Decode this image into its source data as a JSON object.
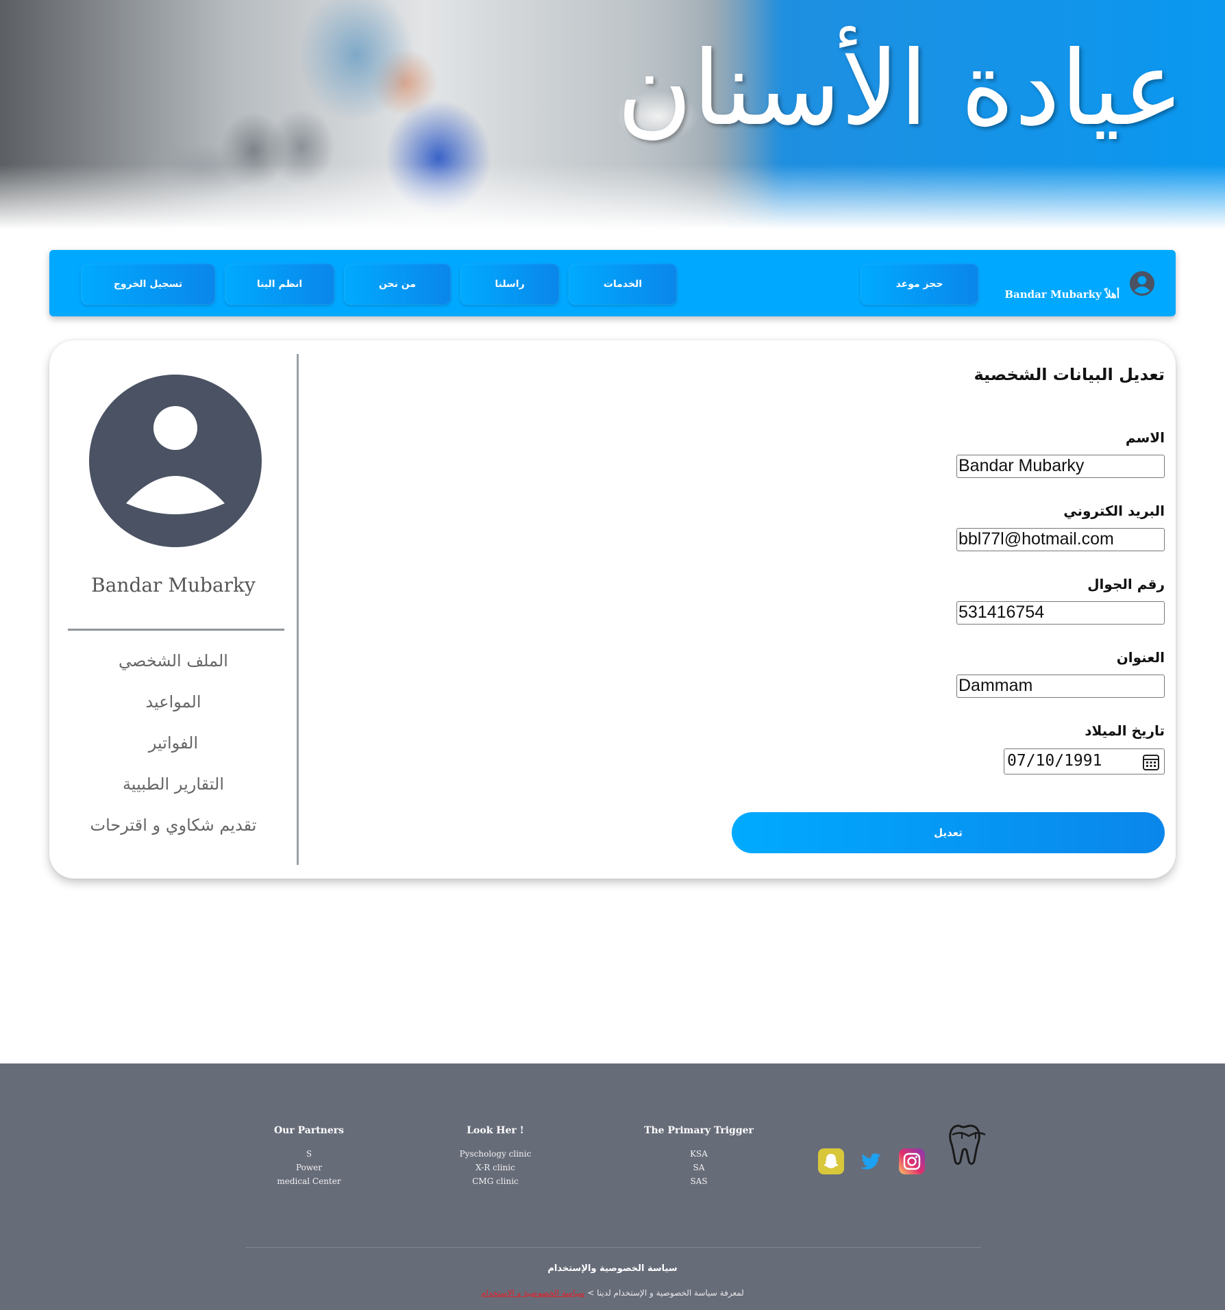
{
  "banner": {
    "title": "عيادة الأسنان"
  },
  "nav": {
    "greeting": "أهلاً",
    "username": "Bandar Mubarky",
    "book": "حجز موعد",
    "services": "الخدمات",
    "contact": "راسلنا",
    "about": "من نحن",
    "join": "انظم الينا",
    "logout": "تسجيل الخروج"
  },
  "sidebar": {
    "name": "Bandar Mubarky",
    "items": [
      {
        "label": "الملف الشخصي"
      },
      {
        "label": "المواعيد"
      },
      {
        "label": "الفواتير"
      },
      {
        "label": "التقارير الطبيية"
      },
      {
        "label": "تقديم شكاوي و اقترحات"
      }
    ]
  },
  "form": {
    "title": "تعديل البيانات الشخصية",
    "name_label": "الاسم",
    "name_value": "Bandar Mubarky",
    "email_label": "البريد الكتروني",
    "email_value": "bbl77l@hotmail.com",
    "phone_label": "رقم الجوال",
    "phone_value": "531416754",
    "address_label": "العنوان",
    "address_value": "Dammam",
    "dob_label": "تاريخ الميلاد",
    "dob_value": "07/10/1991",
    "submit_label": "تعديل"
  },
  "footer": {
    "columns": [
      {
        "title": "Our Partners",
        "items": [
          "S",
          "Power",
          "medical Center"
        ]
      },
      {
        "title": "Look Her !",
        "items": [
          "Pyschology clinic",
          "X-R clinic",
          "CMG clinic"
        ]
      },
      {
        "title": "The Primary Trigger",
        "items": [
          "KSA",
          "SA",
          "SAS"
        ]
      }
    ],
    "social": [
      {
        "icon": "snapchat-icon",
        "color": "#d8c73a"
      },
      {
        "icon": "twitter-icon",
        "color": "#1da1f2"
      },
      {
        "icon": "instagram-icon",
        "color": "#e1306c"
      }
    ],
    "policy_title": "سياسة الخصوصية والإستخدام",
    "policy_note": "لمعرفة سياسة الخصوصية و الإستخدام لدينا >",
    "policy_link": "سياسة الخصوصية و الإستخدام"
  },
  "colors": {
    "primary": "#00a8ff",
    "footer_bg": "#676c79",
    "avatar": "#4a5263"
  }
}
